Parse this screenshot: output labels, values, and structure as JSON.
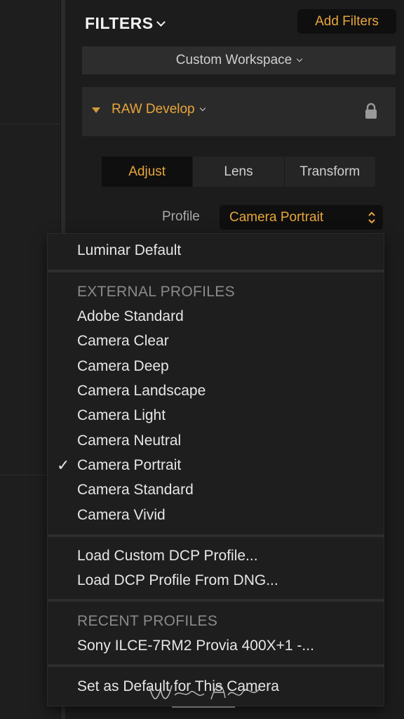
{
  "panel": {
    "title": "FILTERS",
    "add_filters_label": "Add Filters",
    "workspace_label": "Custom Workspace",
    "filter_name": "RAW Develop",
    "tabs": [
      {
        "label": "Adjust",
        "active": true
      },
      {
        "label": "Lens",
        "active": false
      },
      {
        "label": "Transform",
        "active": false
      }
    ],
    "profile_label": "Profile",
    "profile_value": "Camera Portrait"
  },
  "menu": {
    "default_item": "Luminar Default",
    "external_header": "EXTERNAL PROFILES",
    "external_items": [
      "Adobe Standard",
      "Camera Clear",
      "Camera Deep",
      "Camera Landscape",
      "Camera Light",
      "Camera Neutral",
      "Camera Portrait",
      "Camera Standard",
      "Camera Vivid"
    ],
    "checked_item": "Camera Portrait",
    "check_glyph": "✓",
    "load_custom": "Load Custom DCP Profile...",
    "load_dng": "Load DCP Profile From DNG...",
    "recent_header": "RECENT PROFILES",
    "recent_item": "Sony ILCE-7RM2 Provia 400X+1 -...",
    "set_default": "Set as Default for This Camera"
  },
  "colors": {
    "accent": "#e8a63a",
    "panel_bg": "#1c1c1c",
    "menu_bg": "#1e1e1e"
  },
  "icons": {
    "lock": "lock-icon",
    "updown": "updown-chevron-icon",
    "collapse": "triangle-down-icon",
    "check": "checkmark-icon"
  }
}
